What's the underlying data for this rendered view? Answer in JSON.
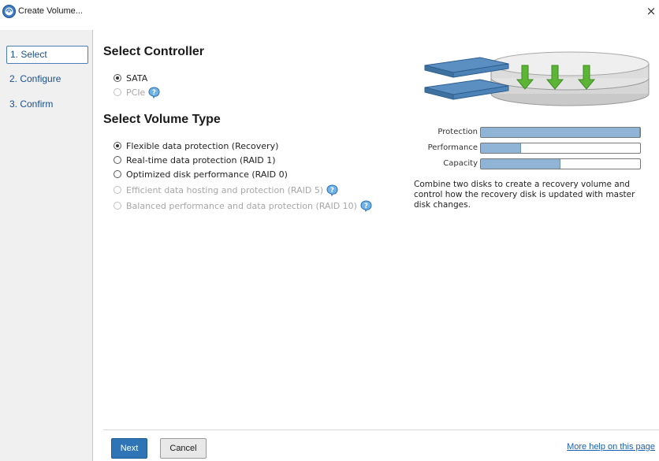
{
  "window": {
    "title": "Create Volume...",
    "app_icon": "intel-rst-icon",
    "close_glyph": "×"
  },
  "sidebar": {
    "items": [
      {
        "label": "1. Select",
        "active": true
      },
      {
        "label": "2. Configure",
        "active": false
      },
      {
        "label": "3. Confirm",
        "active": false
      }
    ]
  },
  "controller": {
    "heading": "Select Controller",
    "options": [
      {
        "label": "SATA",
        "checked": true,
        "disabled": false,
        "help": false
      },
      {
        "label": "PCIe",
        "checked": false,
        "disabled": true,
        "help": true
      }
    ]
  },
  "volume_type": {
    "heading": "Select Volume Type",
    "options": [
      {
        "label": "Flexible data protection (Recovery)",
        "checked": true,
        "disabled": false,
        "help": false
      },
      {
        "label": "Real-time data protection (RAID 1)",
        "checked": false,
        "disabled": false,
        "help": false
      },
      {
        "label": "Optimized disk performance (RAID 0)",
        "checked": false,
        "disabled": false,
        "help": false
      },
      {
        "label": "Efficient data hosting and protection (RAID 5)",
        "checked": false,
        "disabled": true,
        "help": true
      },
      {
        "label": "Balanced performance and data protection (RAID 10)",
        "checked": false,
        "disabled": true,
        "help": true
      }
    ]
  },
  "meters": {
    "protection": {
      "label": "Protection",
      "level": 1.0
    },
    "performance": {
      "label": "Performance",
      "level": 0.25
    },
    "capacity": {
      "label": "Capacity",
      "level": 0.5
    }
  },
  "description": "Combine two disks to create a recovery volume and control how the recovery disk is updated with master disk changes.",
  "footer": {
    "next_label": "Next",
    "cancel_label": "Cancel",
    "help_link": "More help on this page"
  },
  "colors": {
    "accent": "#2f74b5",
    "meter_fill": "#8fb4d6",
    "link": "#1a5fb4",
    "arrow_green": "#5cb535"
  }
}
